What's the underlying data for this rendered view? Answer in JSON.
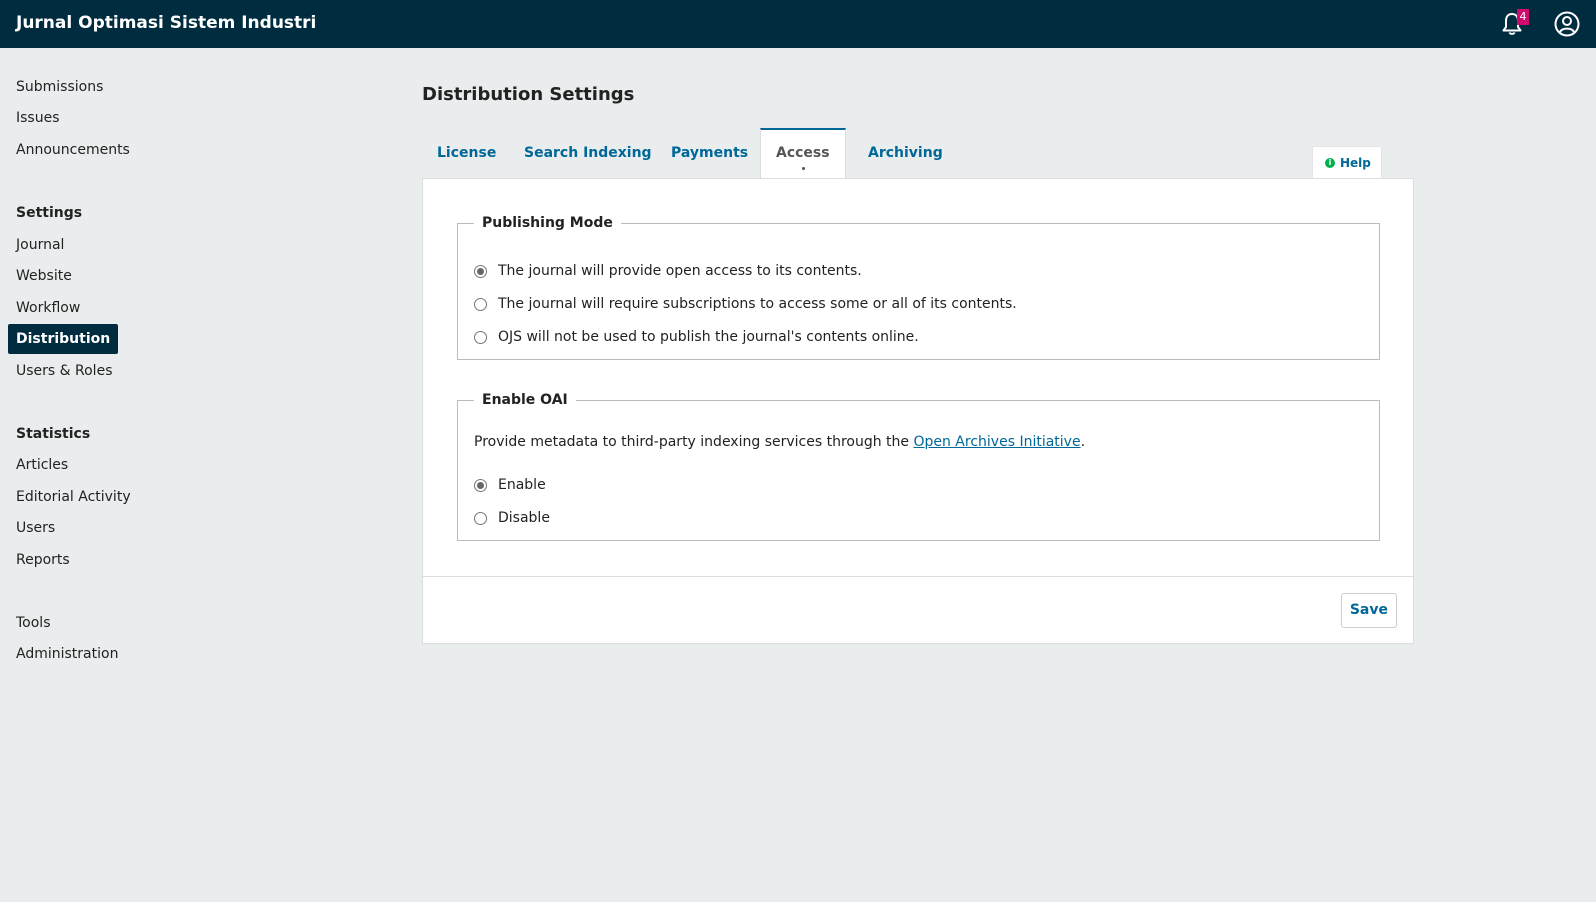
{
  "header": {
    "site_title": "Jurnal Optimasi Sistem Industri",
    "notification_count": "4",
    "icons": {
      "notifications": "bell-icon",
      "user": "user-icon"
    }
  },
  "sidebar": {
    "groups": [
      {
        "items": [
          "Submissions",
          "Issues",
          "Announcements"
        ]
      },
      {
        "heading": "Settings",
        "items": [
          "Journal",
          "Website",
          "Workflow",
          "Distribution",
          "Users & Roles"
        ]
      },
      {
        "heading": "Statistics",
        "items": [
          "Articles",
          "Editorial Activity",
          "Users",
          "Reports"
        ]
      },
      {
        "items": [
          "Tools",
          "Administration"
        ]
      }
    ],
    "active_item": "Distribution"
  },
  "main": {
    "page_title": "Distribution Settings",
    "tabs": [
      "License",
      "Search Indexing",
      "Payments",
      "Access",
      "Archiving"
    ],
    "active_tab": "Access",
    "help_label": "Help",
    "publishing_mode": {
      "legend": "Publishing Mode",
      "options": [
        "The journal will provide open access to its contents.",
        "The journal will require subscriptions to access some or all of its contents.",
        "OJS will not be used to publish the journal's contents online."
      ],
      "selected": "The journal will provide open access to its contents."
    },
    "oai": {
      "legend": "Enable OAI",
      "description_prefix": "Provide metadata to third-party indexing services through the ",
      "description_link": "Open Archives Initiative",
      "description_suffix": ".",
      "options": [
        "Enable",
        "Disable"
      ],
      "selected": "Enable"
    },
    "save_label": "Save"
  },
  "colors": {
    "header_bg": "#002c40",
    "link": "#006798",
    "badge": "#d00a6c",
    "page_bg": "#e9eded"
  }
}
